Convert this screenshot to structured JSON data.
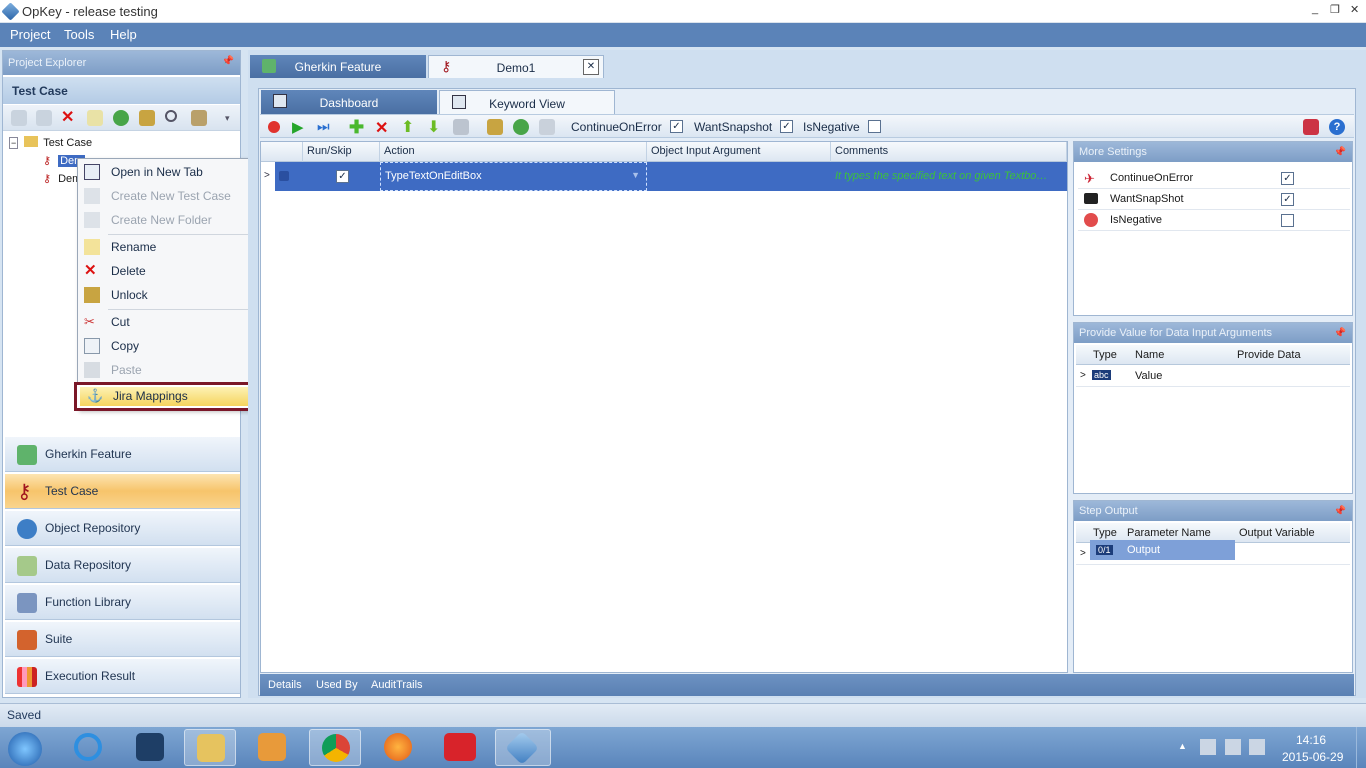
{
  "window": {
    "title": "OpKey - release testing",
    "controls": [
      "_",
      "❐",
      "✕"
    ]
  },
  "menu": [
    "Project",
    "Tools",
    "Help"
  ],
  "explorer": {
    "title": "Project Explorer",
    "section": "Test Case",
    "tree": {
      "root": "Test Case",
      "items": [
        {
          "label": "Demo1",
          "visible": "Dem"
        },
        {
          "label": "Demo2",
          "visible": "Dem"
        }
      ]
    }
  },
  "context_menu": {
    "items": [
      {
        "label": "Open in New Tab",
        "disabled": false,
        "icon": "new-tab-icon"
      },
      {
        "label": "Create New Test Case",
        "disabled": true,
        "icon": "new-testcase-icon"
      },
      {
        "label": "Create New Folder",
        "disabled": true,
        "icon": "new-folder-icon"
      },
      {
        "label": "Rename",
        "disabled": false,
        "icon": "rename-icon"
      },
      {
        "label": "Delete",
        "disabled": false,
        "icon": "delete-icon"
      },
      {
        "label": "Unlock",
        "disabled": false,
        "icon": "unlock-icon"
      },
      {
        "label": "Cut",
        "disabled": false,
        "icon": "cut-icon"
      },
      {
        "label": "Copy",
        "disabled": false,
        "icon": "copy-icon"
      },
      {
        "label": "Paste",
        "disabled": true,
        "icon": "paste-icon"
      },
      {
        "label": "Jira Mappings",
        "disabled": false,
        "icon": "anchor-icon",
        "highlighted": true
      }
    ]
  },
  "nav": [
    {
      "label": "Gherkin Feature",
      "icon": "scroll-icon",
      "active": false
    },
    {
      "label": "Test Case",
      "icon": "key-icon",
      "active": true
    },
    {
      "label": "Object Repository",
      "icon": "gears-icon",
      "active": false
    },
    {
      "label": "Data Repository",
      "icon": "spreadsheet-icon",
      "active": false
    },
    {
      "label": "Function Library",
      "icon": "library-icon",
      "active": false
    },
    {
      "label": "Suite",
      "icon": "briefcase-icon",
      "active": false
    },
    {
      "label": "Execution Result",
      "icon": "bar-chart-icon",
      "active": false
    }
  ],
  "doc_tabs": [
    {
      "label": "Gherkin Feature",
      "active": false
    },
    {
      "label": "Demo1",
      "active": true,
      "close": "✕"
    }
  ],
  "view_tabs": [
    {
      "label": "Dashboard",
      "active": false
    },
    {
      "label": "Keyword View",
      "active": true
    }
  ],
  "toolbar": {
    "options": [
      {
        "label": "ContinueOnError",
        "checked": true
      },
      {
        "label": "WantSnapshot",
        "checked": true
      },
      {
        "label": "IsNegative",
        "checked": false
      }
    ],
    "help": "?"
  },
  "grid": {
    "columns": [
      "Run/Skip",
      "Action",
      "Object Input Argument",
      "Comments"
    ],
    "rows": [
      {
        "run": true,
        "action": "TypeTextOnEditBox",
        "object": "",
        "comment": "It types the specified text on given Textbo…"
      }
    ]
  },
  "bottom_tabs": [
    "Details",
    "Used By",
    "AuditTrails"
  ],
  "more_settings": {
    "title": "More Settings",
    "items": [
      {
        "label": "ContinueOnError",
        "checked": true
      },
      {
        "label": "WantSnapShot",
        "checked": true
      },
      {
        "label": "IsNegative",
        "checked": false
      }
    ]
  },
  "data_input": {
    "title": "Provide Value for Data Input Arguments",
    "columns": [
      "Type",
      "Name",
      "Provide Data"
    ],
    "rows": [
      {
        "type": "abc",
        "name": "Value",
        "data": ""
      }
    ]
  },
  "step_output": {
    "title": "Step Output",
    "columns": [
      "Type",
      "Parameter Name",
      "Output Variable"
    ],
    "rows": [
      {
        "type": "0/1",
        "name": "Output",
        "variable": ""
      }
    ]
  },
  "status": "Saved",
  "taskbar": {
    "time": "14:16",
    "date": "2015-06-29",
    "apps": [
      "start",
      "ie",
      "tool",
      "explorer",
      "media",
      "chrome",
      "firefox",
      "zynga",
      "opkey"
    ]
  },
  "colors": {
    "accent": "#5b83b8",
    "selection": "#3e6bc3",
    "highlight_border": "#7a1728",
    "active_nav": "#f7c46b"
  }
}
